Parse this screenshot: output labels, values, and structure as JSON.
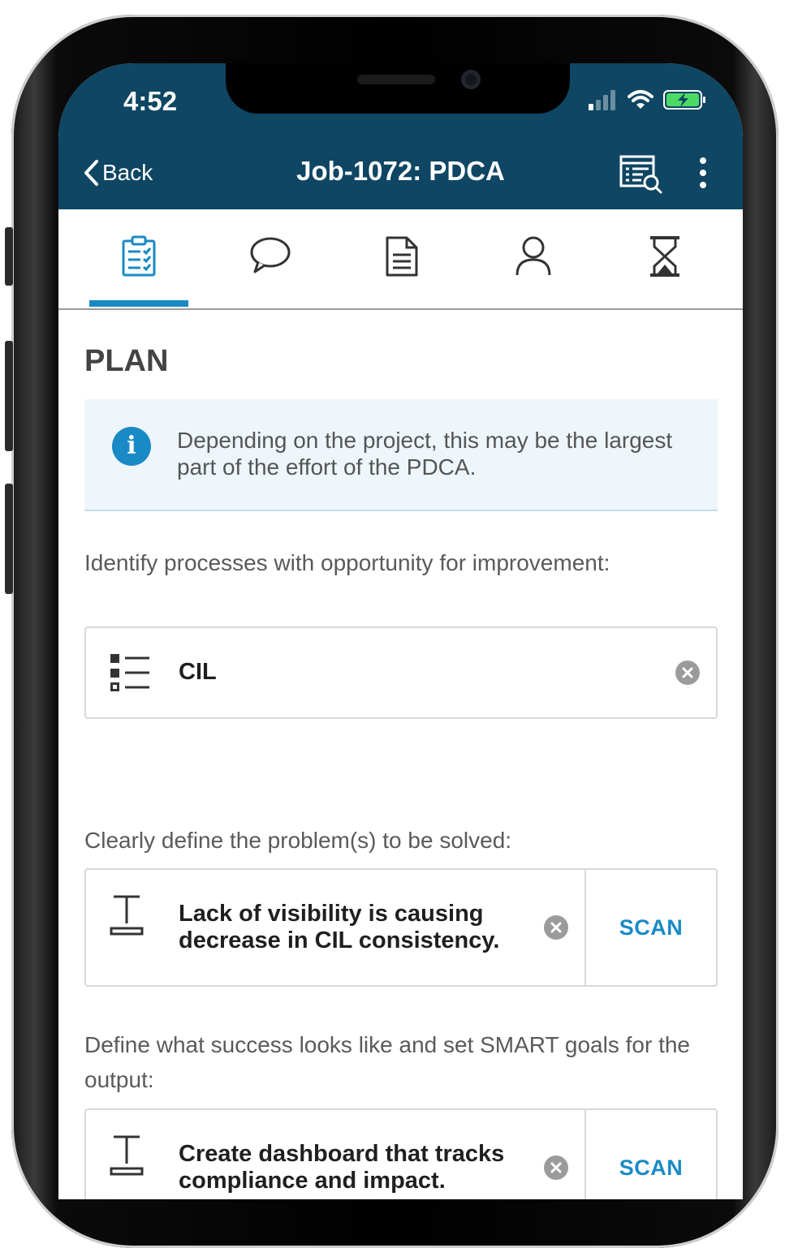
{
  "status_bar": {
    "time": "4:52"
  },
  "nav": {
    "back_label": "Back",
    "title": "Job-1072: PDCA"
  },
  "tabs": [
    {
      "name": "checklist",
      "active": true
    },
    {
      "name": "comments",
      "active": false
    },
    {
      "name": "document",
      "active": false
    },
    {
      "name": "user",
      "active": false
    },
    {
      "name": "history",
      "active": false
    }
  ],
  "section": {
    "title": "PLAN"
  },
  "info": {
    "text": "Depending on the project, this may be the largest part of the effort of the PDCA."
  },
  "fields": [
    {
      "label": "Identify processes with opportunity for improvement:",
      "value": "CIL",
      "icon": "list-icon"
    },
    {
      "label": "Clearly define the problem(s) to be solved:",
      "value": "Lack of visibility is causing decrease in CIL consistency.",
      "icon": "text-field-icon",
      "action": "SCAN"
    },
    {
      "label": "Define what success looks like and set SMART goals for the output:",
      "value": "Create dashboard that tracks compliance and impact.",
      "icon": "text-field-icon",
      "action": "SCAN"
    }
  ],
  "colors": {
    "header": "#0e4663",
    "accent": "#1a8ac6"
  }
}
